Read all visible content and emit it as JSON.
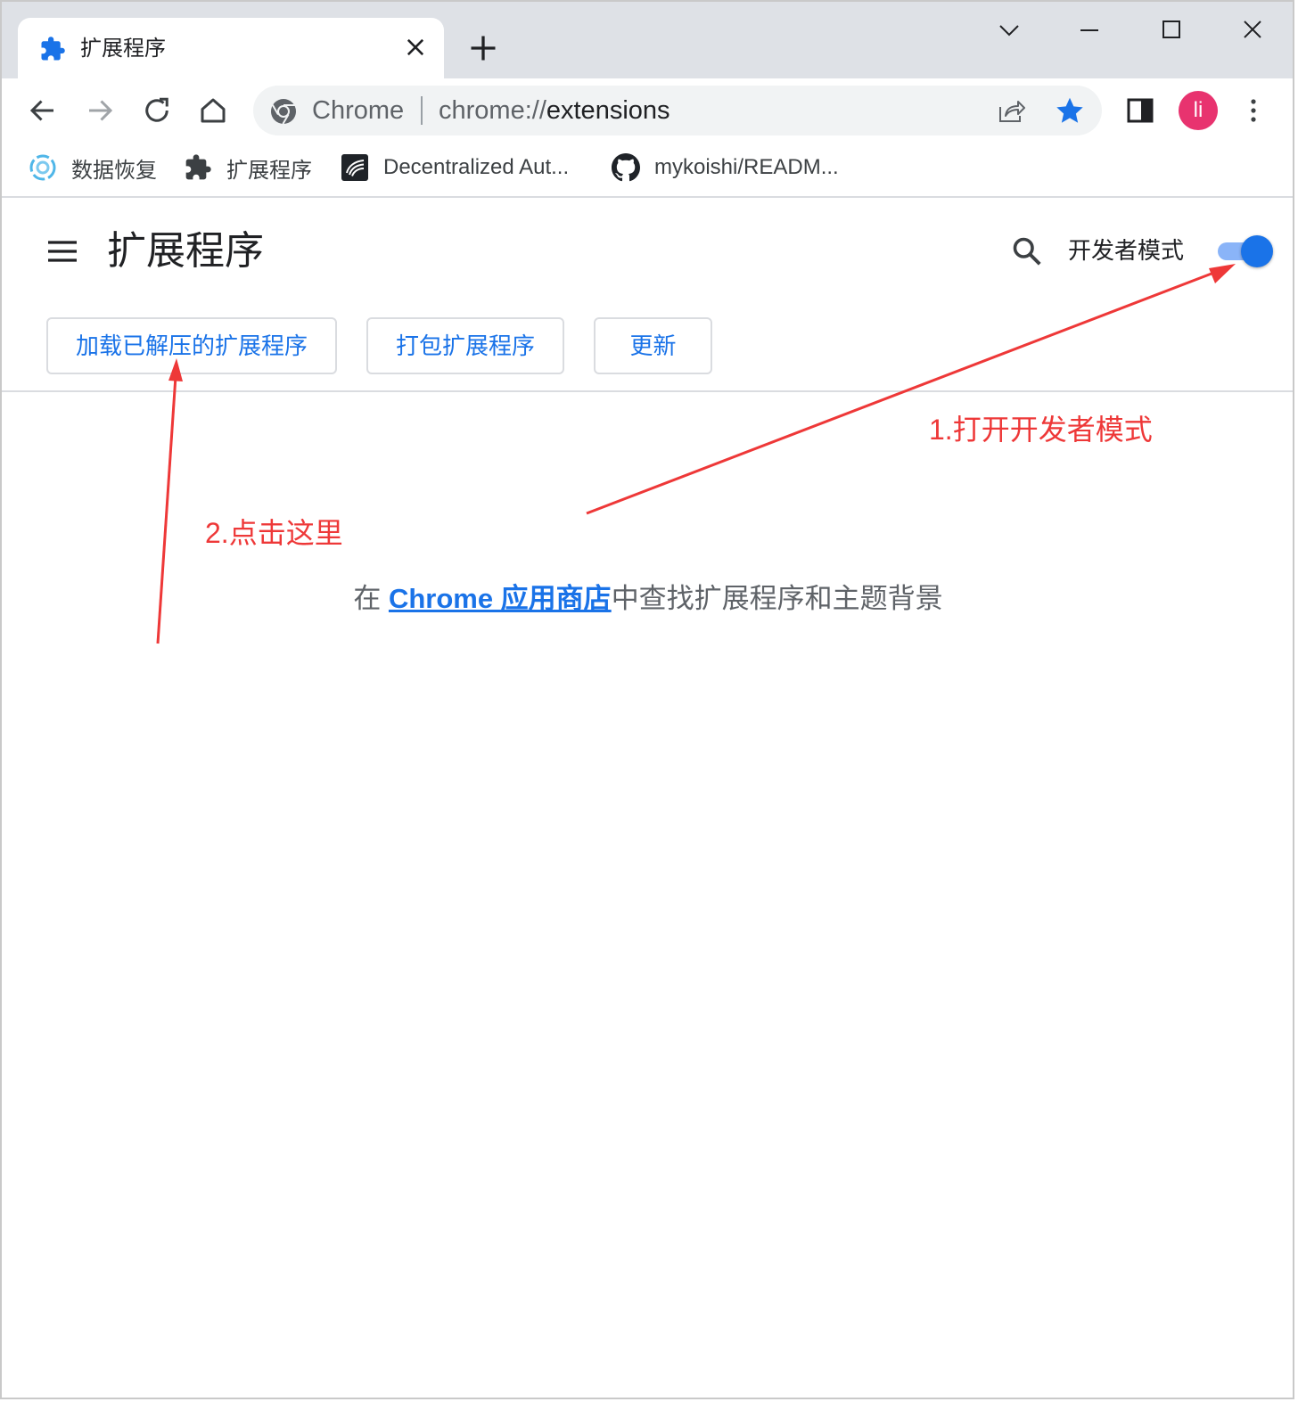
{
  "tab": {
    "title": "扩展程序",
    "icon": "puzzle-icon"
  },
  "toolbar": {
    "site_label": "Chrome",
    "url_scheme": "chrome://",
    "url_host": "extensions",
    "avatar_initial": "li"
  },
  "bookmarks": [
    {
      "label": "数据恢复",
      "icon": "recovery-icon"
    },
    {
      "label": "扩展程序",
      "icon": "puzzle-icon"
    },
    {
      "label": "Decentralized Aut...",
      "icon": "decentralized-icon"
    },
    {
      "label": "mykoishi/READM...",
      "icon": "github-icon"
    }
  ],
  "page": {
    "title": "扩展程序",
    "dev_mode_label": "开发者模式",
    "dev_mode_enabled": true,
    "buttons": {
      "load_unpacked": "加载已解压的扩展程序",
      "pack": "打包扩展程序",
      "update": "更新"
    },
    "store_prefix": "在 ",
    "store_link": "Chrome 应用商店",
    "store_suffix": "中查找扩展程序和主题背景"
  },
  "annotations": {
    "step1": "1.打开开发者模式",
    "step2": "2.点击这里",
    "color": "#ee3838"
  },
  "colors": {
    "accent": "#1a73e8",
    "avatar": "#e8336f",
    "tabstrip": "#dee1e6"
  }
}
